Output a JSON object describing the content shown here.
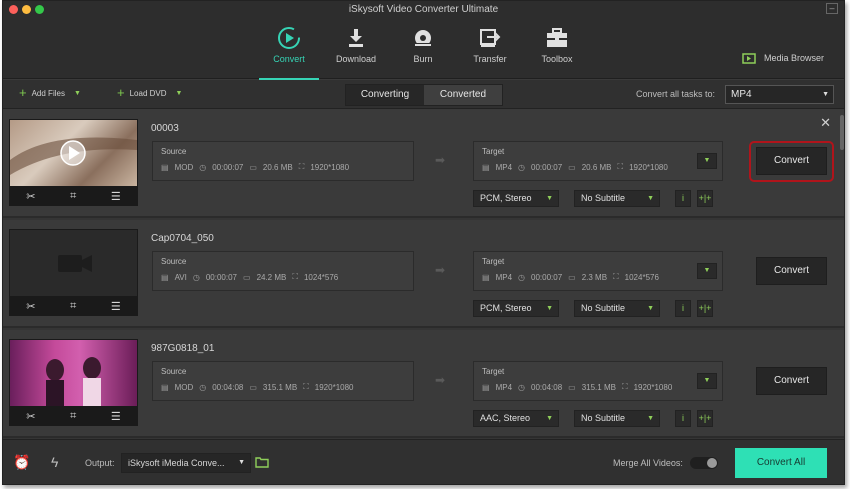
{
  "window": {
    "title": "iSkysoft Video Converter Ultimate"
  },
  "toolbar": {
    "tabs": [
      {
        "label": "Convert",
        "icon": "convert-icon",
        "active": true
      },
      {
        "label": "Download",
        "icon": "download-icon",
        "active": false
      },
      {
        "label": "Burn",
        "icon": "disc-icon",
        "active": false
      },
      {
        "label": "Transfer",
        "icon": "transfer-icon",
        "active": false
      },
      {
        "label": "Toolbox",
        "icon": "toolbox-icon",
        "active": false
      }
    ],
    "media_browser": "Media Browser"
  },
  "subtoolbar": {
    "add_files": "Add Files",
    "load_dvd": "Load DVD",
    "seg_converting": "Converting",
    "seg_converted": "Converted",
    "convert_all_label": "Convert all tasks to:",
    "format": "MP4"
  },
  "tasks": [
    {
      "name": "00003",
      "source": {
        "header": "Source",
        "format": "MOD",
        "duration": "00:00:07",
        "size": "20.6 MB",
        "resolution": "1920*1080"
      },
      "target": {
        "header": "Target",
        "format": "MP4",
        "duration": "00:00:07",
        "size": "20.6 MB",
        "resolution": "1920*1080"
      },
      "audio": "PCM, Stereo",
      "subtitle": "No Subtitle",
      "convert_label": "Convert"
    },
    {
      "name": "Cap0704_050",
      "source": {
        "header": "Source",
        "format": "AVI",
        "duration": "00:00:07",
        "size": "24.2 MB",
        "resolution": "1024*576"
      },
      "target": {
        "header": "Target",
        "format": "MP4",
        "duration": "00:00:07",
        "size": "2.3 MB",
        "resolution": "1024*576"
      },
      "audio": "PCM, Stereo",
      "subtitle": "No Subtitle",
      "convert_label": "Convert"
    },
    {
      "name": "987G0818_01",
      "source": {
        "header": "Source",
        "format": "MOD",
        "duration": "00:04:08",
        "size": "315.1 MB",
        "resolution": "1920*1080"
      },
      "target": {
        "header": "Target",
        "format": "MP4",
        "duration": "00:04:08",
        "size": "315.1 MB",
        "resolution": "1920*1080"
      },
      "audio": "AAC, Stereo",
      "subtitle": "No Subtitle",
      "convert_label": "Convert"
    }
  ],
  "footer": {
    "output_label": "Output:",
    "output_value": "iSkysoft iMedia Conve...",
    "merge_label": "Merge All Videos:",
    "convert_all": "Convert All"
  },
  "colors": {
    "accent": "#36d4b5",
    "convert_all_bg": "#2ee0b5",
    "green_icons": "#8fcf5a",
    "highlight": "#b0141b"
  }
}
